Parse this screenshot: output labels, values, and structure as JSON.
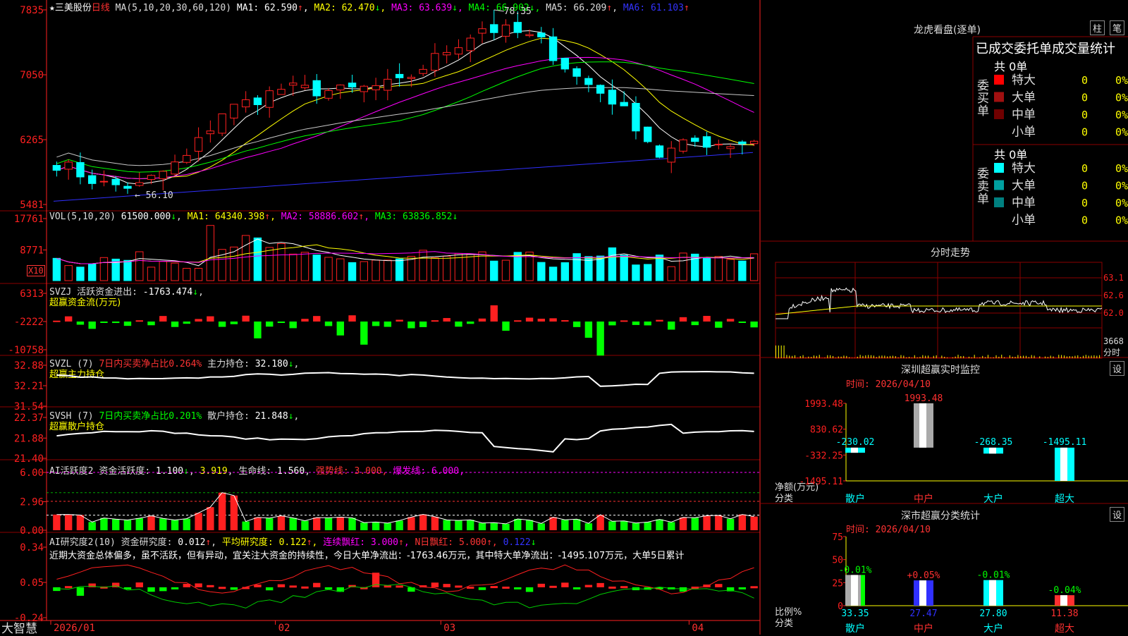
{
  "colors": {
    "up": "#ff2020",
    "down": "#00ffff",
    "grid": "#8b0000",
    "axis": "#ff3030",
    "ma1": "#ffffff",
    "ma2": "#ffff00",
    "ma3": "#ff00ff",
    "ma4": "#00ff00",
    "ma5": "#c8c8c8",
    "ma6": "#3030ff"
  },
  "stock": {
    "name": "★三美股份",
    "period": "日线"
  },
  "panels": {
    "main": {
      "title": "MA(5,10,20,30,60,120)",
      "ma": [
        {
          "label": "MA1:",
          "value": "62.590",
          "arrow": "↑"
        },
        {
          "label": "MA2:",
          "value": "62.470",
          "arrow": "↓"
        },
        {
          "label": "MA3:",
          "value": "63.639",
          "arrow": "↓"
        },
        {
          "label": "MA4:",
          "value": "66.902",
          "arrow": "↓"
        },
        {
          "label": "MA5:",
          "value": "66.209",
          "arrow": "↑"
        },
        {
          "label": "MA6:",
          "value": "61.103",
          "arrow": "↑"
        }
      ],
      "ticks": [
        "7835",
        "7050",
        "6265",
        "5481"
      ],
      "high_label": "78.35",
      "low_label": "56.10"
    },
    "vol": {
      "title": "VOL(5,10,20)",
      "value": "61500.000",
      "arrow": "↓",
      "ma": [
        {
          "label": "MA1:",
          "value": "64340.398",
          "arrow": "↑"
        },
        {
          "label": "MA2:",
          "value": "58886.602",
          "arrow": "↑"
        },
        {
          "label": "MA3:",
          "value": "63836.852",
          "arrow": "↓"
        }
      ],
      "ticks": [
        "17761",
        "8771"
      ],
      "unit": "X10"
    },
    "svzj": {
      "title": "SVZJ",
      "label": "活跃资金进出:",
      "value": "-1763.474",
      "arrow": "↓",
      "sub": "超赢资金流(万元)",
      "ticks": [
        "6313",
        "-2222",
        "-10758"
      ]
    },
    "svzl": {
      "title": "SVZL (7)",
      "ratio": "7日内买卖净占比0.264%",
      "label": "主力持仓:",
      "value": "32.180",
      "arrow": "↓",
      "sub": "超赢主力持仓",
      "ticks": [
        "32.88",
        "32.21",
        "31.54"
      ]
    },
    "svsh": {
      "title": "SVSH (7)",
      "ratio": "7日内买卖净占比0.201%",
      "label": "散户持仓:",
      "value": "21.848",
      "arrow": "↓",
      "sub": "超赢散户持仓",
      "ticks": [
        "22.37",
        "21.88",
        "21.40"
      ]
    },
    "ai1": {
      "title": "AI活跃度2",
      "l1": "资金活跃度:",
      "v1": "1.100",
      "a1": "↓",
      "v1b": "3.919",
      "l2": "生命线:",
      "v2": "1.560",
      "l3": "强势线:",
      "v3": "3.000",
      "l4": "爆发线:",
      "v4": "6.000",
      "ticks": [
        "6.00",
        "2.96",
        "0.00"
      ]
    },
    "ai2": {
      "title": "AI研究度2(10)",
      "l1": "资金研究度:",
      "v1": "0.012",
      "a1": "↑",
      "l2": "平均研究度:",
      "v2": "0.122",
      "a2": "↑",
      "l3": "连续飘红:",
      "v3": "3.000",
      "a3": "↑",
      "l4": "N日飘红:",
      "v4": "5.000",
      "a4": "↑",
      "v5": "0.122",
      "a5": "↓",
      "comment": "近期大资金总体偏多，虽不活跃，但有异动，宜关注大资金的持续性，今日大单净流出：-1763.46万元，其中特大单净流出：-1495.107万元，大单5日累计",
      "ticks": [
        "0.34",
        "0.05",
        "-0.24"
      ]
    }
  },
  "dates": [
    "2026/01",
    "02",
    "03",
    "04"
  ],
  "footer": {
    "brand": "大智慧"
  },
  "side": {
    "lhb_title": "龙虎看盘(逐单)",
    "btn_bar": "柱",
    "btn_bi": "笔",
    "stats_title": "已成交委托单成交量统计",
    "buy": {
      "label": [
        "委",
        "买",
        "单"
      ],
      "count": "共 0单",
      "rows": [
        {
          "name": "特大",
          "qty": "0",
          "pct": "0%",
          "color": "#ff0000"
        },
        {
          "name": "大单",
          "qty": "0",
          "pct": "0%",
          "color": "#a01010"
        },
        {
          "name": "中单",
          "qty": "0",
          "pct": "0%",
          "color": "#700000"
        },
        {
          "name": "小单",
          "qty": "0",
          "pct": "0%",
          "color": ""
        }
      ]
    },
    "sell": {
      "label": [
        "委",
        "卖",
        "单"
      ],
      "count": "共 0单",
      "rows": [
        {
          "name": "特大",
          "qty": "0",
          "pct": "0%",
          "color": "#00ffff"
        },
        {
          "name": "大单",
          "qty": "0",
          "pct": "0%",
          "color": "#00a0a0"
        },
        {
          "name": "中单",
          "qty": "0",
          "pct": "0%",
          "color": "#008080"
        },
        {
          "name": "小单",
          "qty": "0",
          "pct": "0%",
          "color": ""
        }
      ]
    },
    "fenshi": {
      "title": "分时走势",
      "ticks": [
        "63.1",
        "62.6",
        "62.0"
      ],
      "vol_tick": "3668",
      "vol_unit": "分时"
    },
    "monitor": {
      "title": "深圳超赢实时监控",
      "btn": "设",
      "time": "时间: 2026/04/10",
      "ticks": [
        "1993.48",
        "830.62",
        "-332.25",
        "-1495.11"
      ],
      "ylabel": "净额(万元)",
      "xlabel": "分类",
      "bars": [
        {
          "cat": "散户",
          "value": -230.02,
          "label": "-230.02"
        },
        {
          "cat": "中户",
          "value": 1993.48,
          "label": "1993.48"
        },
        {
          "cat": "大户",
          "value": -268.35,
          "label": "-268.35"
        },
        {
          "cat": "超大",
          "value": -1495.11,
          "label": "-1495.11"
        }
      ]
    },
    "classify": {
      "title": "深市超赢分类统计",
      "btn": "设",
      "time": "时间: 2026/04/10",
      "ticks": [
        "75",
        "50",
        "25",
        "0"
      ],
      "ylabel": "比例%",
      "xlabel": "分类",
      "bars": [
        {
          "cat": "散户",
          "value": 33.35,
          "label": "33.35",
          "delta": "-0.01%"
        },
        {
          "cat": "中户",
          "value": 27.47,
          "label": "27.47",
          "delta": "+0.05%"
        },
        {
          "cat": "大户",
          "value": 27.8,
          "label": "27.80",
          "delta": "-0.01%"
        },
        {
          "cat": "超大",
          "value": 11.38,
          "label": "11.38",
          "delta": "-0.04%"
        }
      ]
    }
  },
  "chart_data": {
    "type": "candlestick",
    "price_range": [
      54.81,
      78.35
    ],
    "last": {
      "open": 62.9,
      "close": 62.6,
      "high": 63.0,
      "low": 61.9
    },
    "volume_range": [
      0,
      17761
    ],
    "note_high": 78.35,
    "note_low": 56.1
  }
}
